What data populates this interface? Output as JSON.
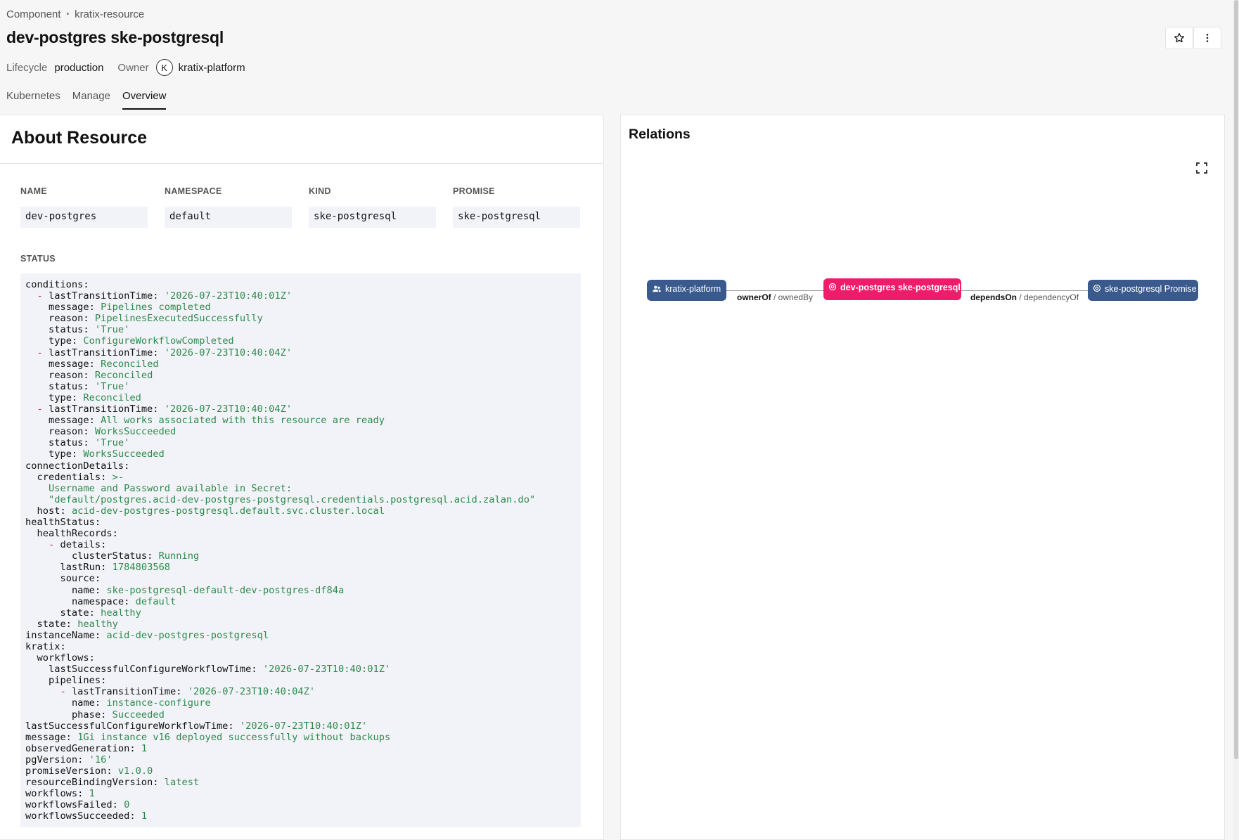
{
  "breadcrumb": {
    "kind": "Component",
    "separator": "•",
    "type": "kratix-resource"
  },
  "title": "dev-postgres ske-postgresql",
  "meta": {
    "lifecycle_label": "Lifecycle",
    "lifecycle_value": "production",
    "owner_label": "Owner",
    "owner_initial": "K",
    "owner_value": "kratix-platform"
  },
  "tabs": [
    {
      "label": "Kubernetes"
    },
    {
      "label": "Manage"
    },
    {
      "label": "Overview"
    }
  ],
  "about": {
    "title": "About Resource",
    "fields": [
      {
        "label": "NAME",
        "value": "dev-postgres"
      },
      {
        "label": "NAMESPACE",
        "value": "default"
      },
      {
        "label": "KIND",
        "value": "ske-postgresql"
      },
      {
        "label": "PROMISE",
        "value": "ske-postgresql"
      }
    ],
    "status_label": "STATUS",
    "status_yaml": [
      {
        "indent": 0,
        "key": "conditions:",
        "value": ""
      },
      {
        "indent": 2,
        "dash": true,
        "key": "lastTransitionTime:",
        "value": "'2026-07-23T10:40:01Z'"
      },
      {
        "indent": 4,
        "key": "message:",
        "value": "Pipelines completed"
      },
      {
        "indent": 4,
        "key": "reason:",
        "value": "PipelinesExecutedSuccessfully"
      },
      {
        "indent": 4,
        "key": "status:",
        "value": "'True'"
      },
      {
        "indent": 4,
        "key": "type:",
        "value": "ConfigureWorkflowCompleted"
      },
      {
        "indent": 2,
        "dash": true,
        "key": "lastTransitionTime:",
        "value": "'2026-07-23T10:40:04Z'"
      },
      {
        "indent": 4,
        "key": "message:",
        "value": "Reconciled"
      },
      {
        "indent": 4,
        "key": "reason:",
        "value": "Reconciled"
      },
      {
        "indent": 4,
        "key": "status:",
        "value": "'True'"
      },
      {
        "indent": 4,
        "key": "type:",
        "value": "Reconciled"
      },
      {
        "indent": 2,
        "dash": true,
        "key": "lastTransitionTime:",
        "value": "'2026-07-23T10:40:04Z'"
      },
      {
        "indent": 4,
        "key": "message:",
        "value": "All works associated with this resource are ready"
      },
      {
        "indent": 4,
        "key": "reason:",
        "value": "WorksSucceeded"
      },
      {
        "indent": 4,
        "key": "status:",
        "value": "'True'"
      },
      {
        "indent": 4,
        "key": "type:",
        "value": "WorksSucceeded"
      },
      {
        "indent": 0,
        "key": "connectionDetails:",
        "value": ""
      },
      {
        "indent": 2,
        "key": "credentials:",
        "value": ">-"
      },
      {
        "indent": 4,
        "key": "",
        "value": "Username and Password available in Secret:"
      },
      {
        "indent": 4,
        "key": "",
        "value": "\"default/postgres.acid-dev-postgres-postgresql.credentials.postgresql.acid.zalan.do\""
      },
      {
        "indent": 2,
        "key": "host:",
        "value": "acid-dev-postgres-postgresql.default.svc.cluster.local"
      },
      {
        "indent": 0,
        "key": "healthStatus:",
        "value": ""
      },
      {
        "indent": 2,
        "key": "healthRecords:",
        "value": ""
      },
      {
        "indent": 4,
        "dash": true,
        "key": "details:",
        "value": ""
      },
      {
        "indent": 8,
        "key": "clusterStatus:",
        "value": "Running"
      },
      {
        "indent": 6,
        "key": "lastRun:",
        "value": "1784803568"
      },
      {
        "indent": 6,
        "key": "source:",
        "value": ""
      },
      {
        "indent": 8,
        "key": "name:",
        "value": "ske-postgresql-default-dev-postgres-df84a"
      },
      {
        "indent": 8,
        "key": "namespace:",
        "value": "default"
      },
      {
        "indent": 6,
        "key": "state:",
        "value": "healthy"
      },
      {
        "indent": 2,
        "key": "state:",
        "value": "healthy"
      },
      {
        "indent": 0,
        "key": "instanceName:",
        "value": "acid-dev-postgres-postgresql"
      },
      {
        "indent": 0,
        "key": "kratix:",
        "value": ""
      },
      {
        "indent": 2,
        "key": "workflows:",
        "value": ""
      },
      {
        "indent": 4,
        "key": "lastSuccessfulConfigureWorkflowTime:",
        "value": "'2026-07-23T10:40:01Z'"
      },
      {
        "indent": 4,
        "key": "pipelines:",
        "value": ""
      },
      {
        "indent": 6,
        "dash": true,
        "key": "lastTransitionTime:",
        "value": "'2026-07-23T10:40:04Z'"
      },
      {
        "indent": 8,
        "key": "name:",
        "value": "instance-configure"
      },
      {
        "indent": 8,
        "key": "phase:",
        "value": "Succeeded"
      },
      {
        "indent": 0,
        "key": "lastSuccessfulConfigureWorkflowTime:",
        "value": "'2026-07-23T10:40:01Z'"
      },
      {
        "indent": 0,
        "key": "message:",
        "value": "1Gi instance v16 deployed successfully without backups"
      },
      {
        "indent": 0,
        "key": "observedGeneration:",
        "value": "1"
      },
      {
        "indent": 0,
        "key": "pgVersion:",
        "value": "'16'"
      },
      {
        "indent": 0,
        "key": "promiseVersion:",
        "value": "v1.0.0"
      },
      {
        "indent": 0,
        "key": "resourceBindingVersion:",
        "value": "latest"
      },
      {
        "indent": 0,
        "key": "workflows:",
        "value": "1"
      },
      {
        "indent": 0,
        "key": "workflowsFailed:",
        "value": "0"
      },
      {
        "indent": 0,
        "key": "workflowsSucceeded:",
        "value": "1"
      }
    ]
  },
  "relations": {
    "title": "Relations",
    "nodes": [
      {
        "label": "kratix-platform",
        "icon": "group-icon"
      },
      {
        "label": "dev-postgres ske-postgresql",
        "icon": "component-icon"
      },
      {
        "label": "ske-postgresql Promise",
        "icon": "component-icon"
      }
    ],
    "edges": [
      {
        "primary": "ownerOf",
        "secondary": "/ ownedBy"
      },
      {
        "primary": "dependsOn",
        "secondary": "/ dependencyOf"
      }
    ]
  },
  "colors": {
    "accent_node": "#f01b6a",
    "blue_node": "#3a5a8e",
    "yaml_value": "#2d8a4a",
    "yaml_dash": "#c0254b"
  }
}
